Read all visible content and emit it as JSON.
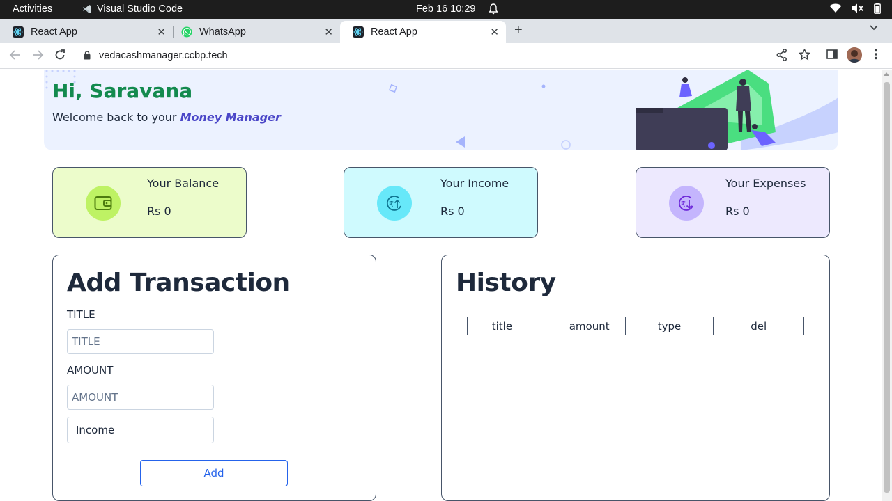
{
  "os_bar": {
    "activities": "Activities",
    "app_name": "Visual Studio Code",
    "clock": "Feb 16  10:29"
  },
  "browser": {
    "tabs": [
      {
        "title": "React App",
        "icon": "react-icon"
      },
      {
        "title": "WhatsApp",
        "icon": "whatsapp-icon"
      },
      {
        "title": "React App",
        "icon": "react-icon",
        "active": true
      }
    ],
    "url": "vedacashmanager.ccbp.tech"
  },
  "banner": {
    "greeting": "Hi, Saravana",
    "welcome_prefix": "Welcome back to your ",
    "app_name": "Money Manager"
  },
  "cards": [
    {
      "label": "Your Balance",
      "value": "Rs 0",
      "icon": "wallet-icon",
      "color": "#ecfccb"
    },
    {
      "label": "Your Income",
      "value": "Rs 0",
      "icon": "income-icon",
      "color": "#cffafe"
    },
    {
      "label": "Your Expenses",
      "value": "Rs 0",
      "icon": "expense-icon",
      "color": "#ede9fe"
    }
  ],
  "add_transaction": {
    "heading": "Add Transaction",
    "title_label": "TITLE",
    "title_placeholder": "TITLE",
    "amount_label": "AMOUNT",
    "amount_placeholder": "AMOUNT",
    "type_value": "Income",
    "add_button": "Add"
  },
  "history": {
    "heading": "History",
    "columns": [
      "title",
      "amount",
      "type",
      "del"
    ]
  }
}
